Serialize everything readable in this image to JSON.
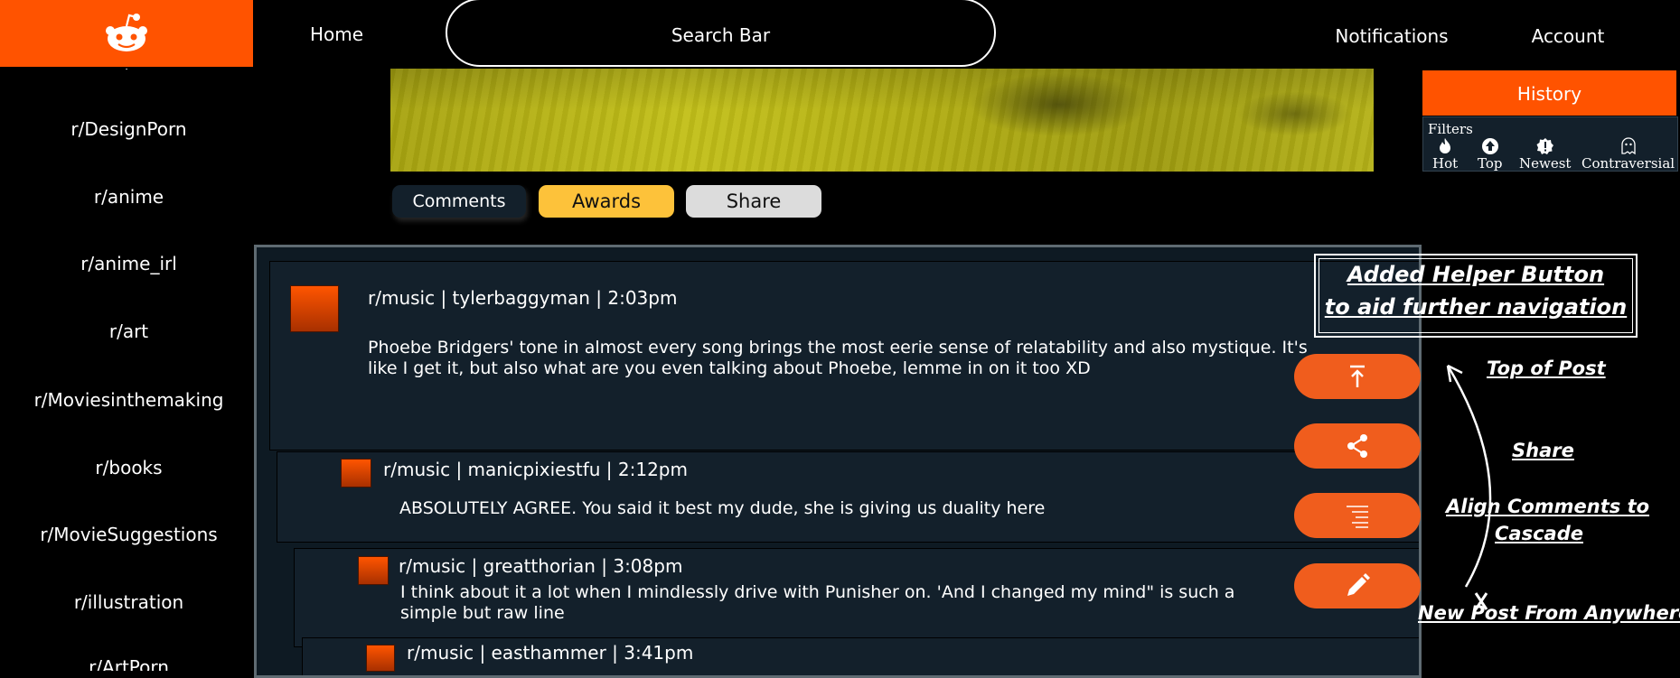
{
  "header": {
    "home_label": "Home",
    "search_label": "Search Bar",
    "notifications_label": "Notifications",
    "account_label": "Account",
    "brand_color": "#ff5300"
  },
  "sidebar": {
    "items": [
      {
        "label": "r/DesignPorn"
      },
      {
        "label": "r/anime"
      },
      {
        "label": "r/anime_irl"
      },
      {
        "label": "r/art"
      },
      {
        "label": "r/Moviesinthemaking"
      },
      {
        "label": "r/books"
      },
      {
        "label": "r/MovieSuggestions"
      },
      {
        "label": "r/illustration"
      },
      {
        "label": "r/ArtPorn"
      }
    ]
  },
  "post_actions": {
    "comments_label": "Comments",
    "awards_label": "Awards",
    "share_label": "Share"
  },
  "right_panel": {
    "history_label": "History",
    "filters_label": "Filters",
    "filters": [
      {
        "label": "Hot",
        "icon": "flame-icon"
      },
      {
        "label": "Top",
        "icon": "up-arrow-icon"
      },
      {
        "label": "Newest",
        "icon": "alert-icon"
      },
      {
        "label": "Contraversial",
        "icon": "ghost-icon"
      }
    ]
  },
  "comments": [
    {
      "meta": "r/music | tylerbaggyman | 2:03pm",
      "body": "Phoebe Bridgers' tone in almost every song brings the most eerie sense of relatability and also mystique. It's like I get it, but also what are you even talking about Phoebe, lemme in on it too XD"
    },
    {
      "meta": "r/music | manicpixiestfu | 2:12pm",
      "body": "ABSOLUTELY AGREE. You said it best my dude, she is giving us duality here"
    },
    {
      "meta": "r/music | greatthorian | 3:08pm",
      "body": "I think about it a lot when I mindlessly drive with Punisher on. 'And I changed my mind\" is such a simple but raw line"
    },
    {
      "meta": "r/music | easthammer | 3:41pm",
      "body": ""
    }
  ],
  "helper_buttons": [
    {
      "icon": "arrow-to-top-icon"
    },
    {
      "icon": "share-icon"
    },
    {
      "icon": "align-icon"
    },
    {
      "icon": "pencil-icon"
    }
  ],
  "annotations": {
    "callout_line1": "Added Helper Button",
    "callout_line2": "to aid further navigation",
    "top_of_post": "Top of Post",
    "share": "Share",
    "align_line1": "Align Comments to",
    "align_line2": "Cascade",
    "new_post": "New Post From Anywhere"
  }
}
